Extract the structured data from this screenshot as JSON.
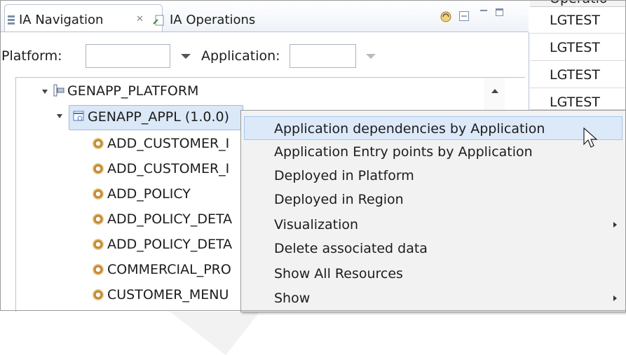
{
  "tabs": [
    {
      "label": "IA Navigation",
      "close_glyph": "✕",
      "active": true,
      "icon": "navigation-icon"
    },
    {
      "label": "IA Operations",
      "active": false,
      "icon": "operations-icon"
    }
  ],
  "toolbar": {
    "icons": [
      "sync-icon",
      "collapse-all-icon",
      "minimize-icon",
      "maximize-icon"
    ]
  },
  "filters": {
    "platform_label": "Platform:",
    "platform_value": "",
    "application_label": "Application:",
    "application_value": ""
  },
  "tree": {
    "platform": "GENAPP_PLATFORM",
    "application": "GENAPP_APPL (1.0.0)",
    "children": [
      "ADD_CUSTOMER_I",
      "ADD_CUSTOMER_I",
      "ADD_POLICY",
      "ADD_POLICY_DETA",
      "ADD_POLICY_DETA",
      "COMMERCIAL_PRO",
      "CUSTOMER_MENU"
    ]
  },
  "operations_table": {
    "header": "Operatio",
    "rows": [
      "LGTEST",
      "LGTEST",
      "LGTEST",
      "LGTEST"
    ]
  },
  "context_menu": {
    "items": [
      {
        "label": "Application dependencies by Application",
        "highlighted": true
      },
      {
        "label": "Application Entry points by Application"
      },
      {
        "label": "Deployed in Platform"
      },
      {
        "label": "Deployed in Region"
      },
      {
        "label": "Visualization",
        "submenu": true
      },
      {
        "label": "Delete associated data"
      },
      {
        "label": "Show All Resources"
      },
      {
        "label": "Show",
        "submenu": true
      }
    ]
  },
  "colors": {
    "selection_bg": "#dbe8f8",
    "menu_bg": "#f2f2f2",
    "menu_highlight": "#dbe9f9",
    "tab_border": "#b7c2d2"
  }
}
